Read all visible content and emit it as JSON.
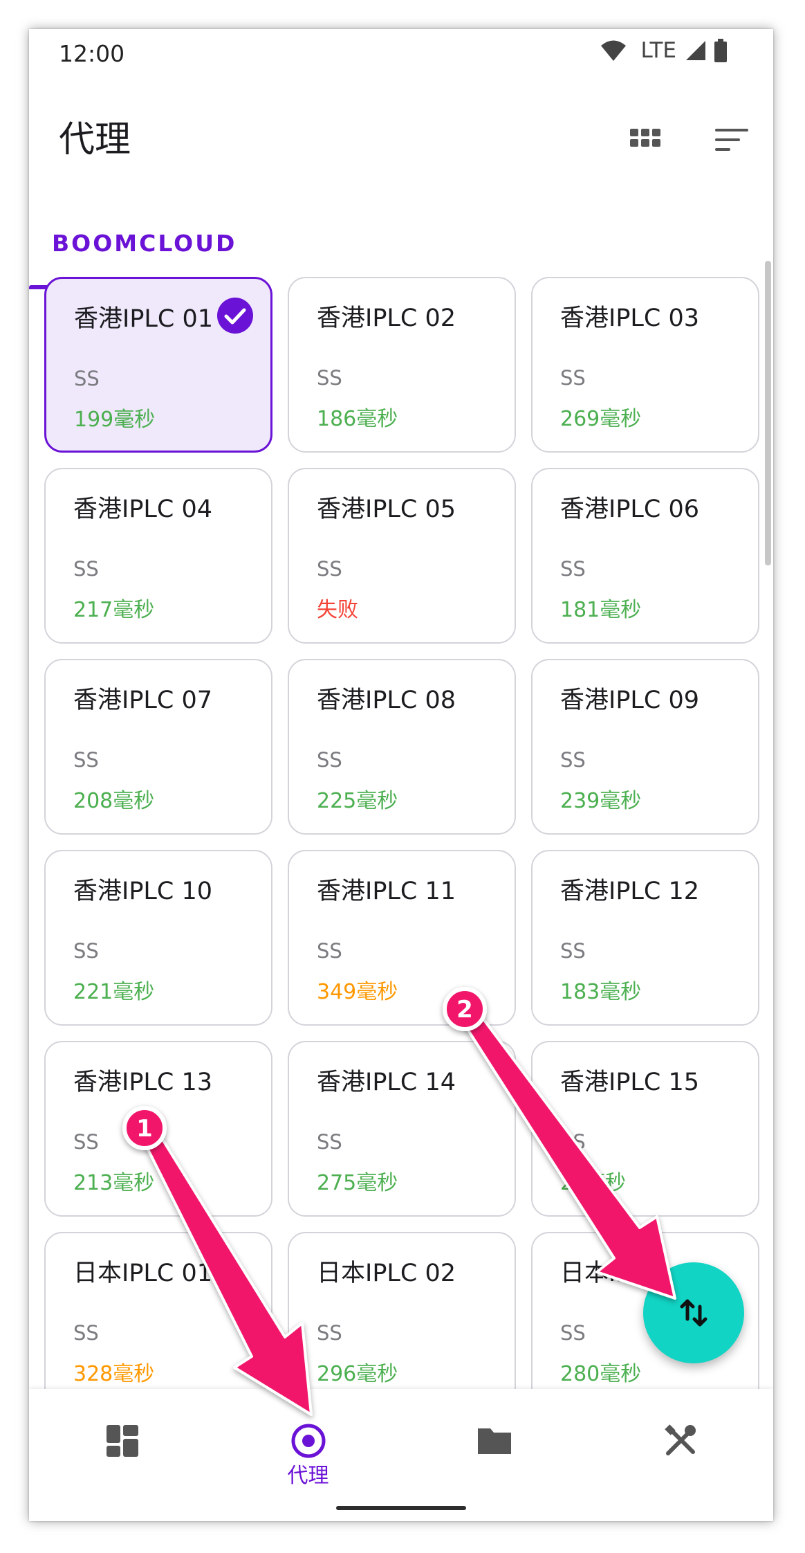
{
  "status_bar": {
    "time": "12:00",
    "network": "LTE",
    "icons": [
      "wifi-icon",
      "signal-icon",
      "battery-icon"
    ]
  },
  "app_bar": {
    "title": "代理",
    "actions": [
      "grid-view-icon",
      "sort-icon"
    ]
  },
  "tabs": [
    {
      "label": "BOOMCLOUD",
      "selected": true
    }
  ],
  "proxies": [
    {
      "name": "香港IPLC 01",
      "type": "SS",
      "delay": "199毫秒",
      "status": "good",
      "selected": true
    },
    {
      "name": "香港IPLC 02",
      "type": "SS",
      "delay": "186毫秒",
      "status": "good"
    },
    {
      "name": "香港IPLC 03",
      "type": "SS",
      "delay": "269毫秒",
      "status": "good"
    },
    {
      "name": "香港IPLC 04",
      "type": "SS",
      "delay": "217毫秒",
      "status": "good"
    },
    {
      "name": "香港IPLC 05",
      "type": "SS",
      "delay": "失败",
      "status": "fail"
    },
    {
      "name": "香港IPLC 06",
      "type": "SS",
      "delay": "181毫秒",
      "status": "good"
    },
    {
      "name": "香港IPLC 07",
      "type": "SS",
      "delay": "208毫秒",
      "status": "good"
    },
    {
      "name": "香港IPLC 08",
      "type": "SS",
      "delay": "225毫秒",
      "status": "good"
    },
    {
      "name": "香港IPLC 09",
      "type": "SS",
      "delay": "239毫秒",
      "status": "good"
    },
    {
      "name": "香港IPLC 10",
      "type": "SS",
      "delay": "221毫秒",
      "status": "good"
    },
    {
      "name": "香港IPLC 11",
      "type": "SS",
      "delay": "349毫秒",
      "status": "slow"
    },
    {
      "name": "香港IPLC 12",
      "type": "SS",
      "delay": "183毫秒",
      "status": "good"
    },
    {
      "name": "香港IPLC 13",
      "type": "SS",
      "delay": "213毫秒",
      "status": "good"
    },
    {
      "name": "香港IPLC 14",
      "type": "SS",
      "delay": "275毫秒",
      "status": "good"
    },
    {
      "name": "香港IPLC 15",
      "type": "SS",
      "delay": "2?毫秒",
      "status": "good"
    },
    {
      "name": "日本IPLC 01",
      "type": "SS",
      "delay": "328毫秒",
      "status": "slow"
    },
    {
      "name": "日本IPLC 02",
      "type": "SS",
      "delay": "296毫秒",
      "status": "good"
    },
    {
      "name": "日本IPL",
      "type": "SS",
      "delay": "280毫秒",
      "status": "good"
    }
  ],
  "status_colors": {
    "good": "#4caf50",
    "slow": "#ff9800",
    "fail": "#f44336"
  },
  "accent_color": "#6a12d6",
  "fab": {
    "icon": "swap-vertical-icon",
    "color": "#11d4c4"
  },
  "bottom_nav": [
    {
      "id": "dashboard",
      "icon": "dashboard-icon",
      "label": "",
      "selected": false
    },
    {
      "id": "proxies",
      "icon": "proxy-radio-icon",
      "label": "代理",
      "selected": true
    },
    {
      "id": "profiles",
      "icon": "folder-icon",
      "label": "",
      "selected": false
    },
    {
      "id": "tools",
      "icon": "tools-icon",
      "label": "",
      "selected": false
    }
  ],
  "annotations": [
    {
      "number": "1",
      "target": "bottom nav proxies tab"
    },
    {
      "number": "2",
      "target": "floating action button"
    }
  ]
}
